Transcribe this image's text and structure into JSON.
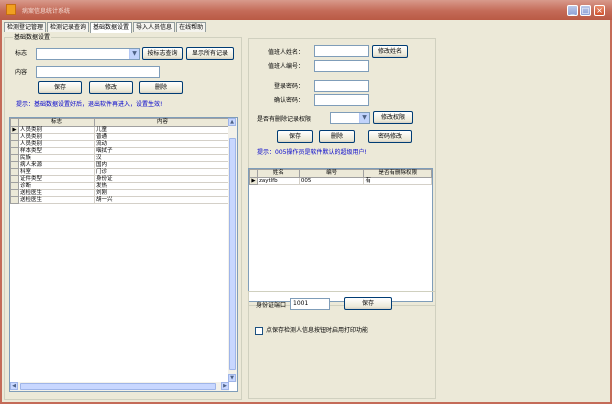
{
  "window": {
    "title": "病案信息统计系统",
    "min": "_",
    "max": "□",
    "close": "×"
  },
  "tabs": [
    "检测登记管理",
    "检测记录查询",
    "基础数据设置",
    "导入人员信息",
    "在线帮助"
  ],
  "basic": {
    "group_label": "基础数据设置",
    "flag_label": "标志",
    "flag_value": "",
    "show_by_flag_btn": "按标志查询",
    "show_all_btn": "显示所有记录",
    "content_label": "内容",
    "content_value": "",
    "save_btn": "保存",
    "edit_btn": "修改",
    "delete_btn": "删除",
    "hint": "提示：基础数据设置好后，退出软件再进入，设置生效!",
    "columns": [
      "标志",
      "内容"
    ],
    "rows": [
      [
        "人员类别",
        "儿童"
      ],
      [
        "人员类别",
        "普通"
      ],
      [
        "人员类别",
        "流动"
      ],
      [
        "样本类型",
        "咽拭子"
      ],
      [
        "民族",
        "汉"
      ],
      [
        "病人来源",
        "国内"
      ],
      [
        "科室",
        "门诊"
      ],
      [
        "证件类型",
        "身份证"
      ],
      [
        "诊断",
        "发热"
      ],
      [
        "送检医生",
        "刘刚"
      ],
      [
        "送检医生",
        "胡一兴"
      ]
    ]
  },
  "user": {
    "name_label": "值班人姓名：",
    "name_value": "",
    "change_name_btn": "修改姓名",
    "id_label": "值班人编号：",
    "id_value": "",
    "pwd_label": "登录密码：",
    "pwd_value": "",
    "confirm_label": "确认密码：",
    "confirm_value": "",
    "perm_label": "是否有删除记录权限",
    "perm_value": "",
    "change_perm_btn": "修改权限",
    "save_btn": "保存",
    "delete_btn": "删除",
    "change_pwd_btn": "密码修改",
    "hint": "提示：005操作员是软件默认的超级用户!",
    "columns": [
      "姓名",
      "编号",
      "是否有删除权限"
    ],
    "rows": [
      [
        "zaytlfb",
        "005",
        "有"
      ]
    ]
  },
  "port": {
    "label": "身份证端口",
    "value": "1001",
    "save_btn": "保存",
    "checkbox_label": "点保存检测人信息按钮时启用打印功能"
  }
}
